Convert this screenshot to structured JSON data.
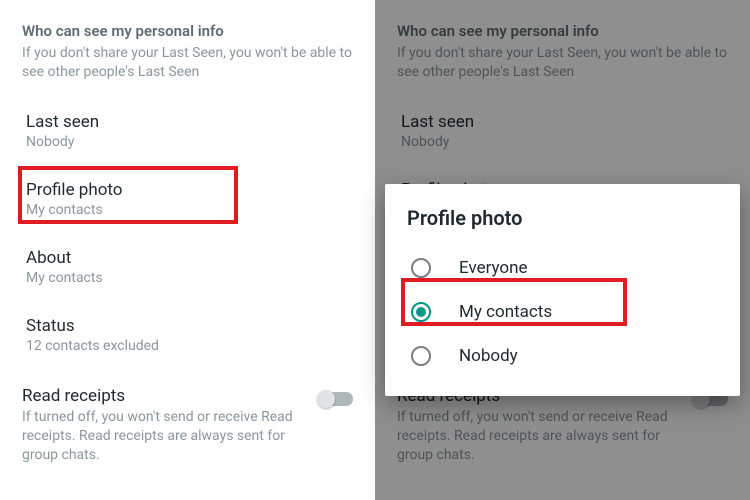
{
  "header": {
    "title": "Who can see my personal info",
    "subtitle": "If you don't share your Last Seen, you won't be able to see other people's Last Seen"
  },
  "items": {
    "last_seen": {
      "label": "Last seen",
      "value": "Nobody"
    },
    "profile_photo": {
      "label": "Profile photo",
      "value": "My contacts"
    },
    "about": {
      "label": "About",
      "value": "My contacts"
    },
    "status": {
      "label": "Status",
      "value": "12 contacts excluded"
    }
  },
  "read_receipts": {
    "label": "Read receipts",
    "subtitle": "If turned off, you won't send or receive Read receipts. Read receipts are always sent for group chats."
  },
  "dialog": {
    "title": "Profile photo",
    "options": {
      "everyone": "Everyone",
      "my_contacts": "My contacts",
      "nobody": "Nobody"
    }
  }
}
